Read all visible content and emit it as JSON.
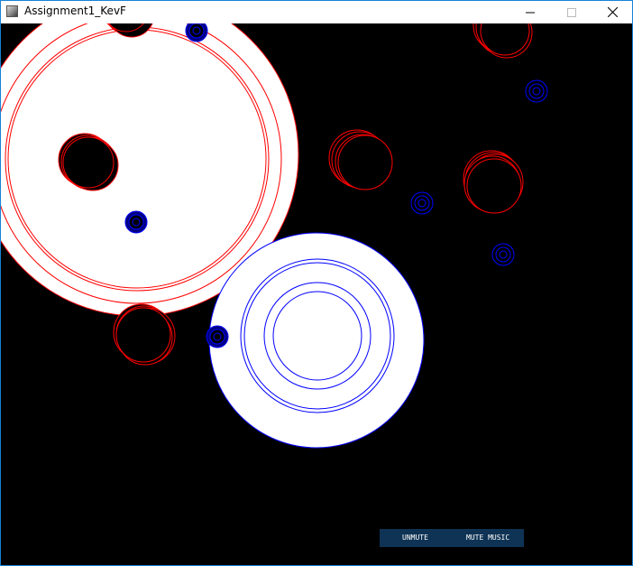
{
  "window": {
    "title": "Assignment1_KevF",
    "icon": "processing-app-icon",
    "controls": [
      "minimize-icon",
      "maximize-icon",
      "close-icon"
    ]
  },
  "canvas": {
    "background_color": "#000000",
    "red_color": "#ff0000",
    "blue_color": "#0000ff",
    "dark_blue_fill": "#000080",
    "big_circle_fill": "#ffffff"
  },
  "hud": {
    "background_color": "#0f3354",
    "unmute_label": "UNMUTE",
    "mute_music_label": "MUTE MUSIC"
  }
}
